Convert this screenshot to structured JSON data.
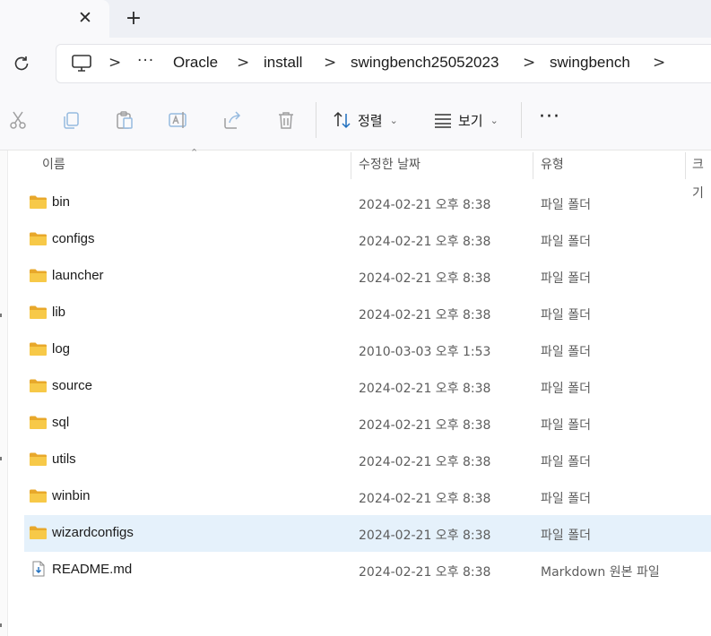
{
  "tabs": {
    "close_label": "✕",
    "new_tab_label": "+"
  },
  "address": {
    "more_label": "···",
    "crumbs": [
      "Oracle",
      "install",
      "swingbench25052023",
      "swingbench"
    ],
    "separator": ">"
  },
  "toolbar": {
    "actions": [
      "cut-icon",
      "copy-icon",
      "paste-icon",
      "rename-icon",
      "share-icon",
      "delete-icon"
    ],
    "sort_label": "정렬",
    "view_label": "보기",
    "more_label": "···"
  },
  "columns": {
    "name": "이름",
    "date": "수정한 날짜",
    "type": "유형",
    "size": "크기"
  },
  "files": [
    {
      "name": "bin",
      "date": "2024-02-21 오후 8:38",
      "type": "파일 폴더",
      "kind": "folder"
    },
    {
      "name": "configs",
      "date": "2024-02-21 오후 8:38",
      "type": "파일 폴더",
      "kind": "folder"
    },
    {
      "name": "launcher",
      "date": "2024-02-21 오후 8:38",
      "type": "파일 폴더",
      "kind": "folder"
    },
    {
      "name": "lib",
      "date": "2024-02-21 오후 8:38",
      "type": "파일 폴더",
      "kind": "folder"
    },
    {
      "name": "log",
      "date": "2010-03-03 오후 1:53",
      "type": "파일 폴더",
      "kind": "folder"
    },
    {
      "name": "source",
      "date": "2024-02-21 오후 8:38",
      "type": "파일 폴더",
      "kind": "folder"
    },
    {
      "name": "sql",
      "date": "2024-02-21 오후 8:38",
      "type": "파일 폴더",
      "kind": "folder"
    },
    {
      "name": "utils",
      "date": "2024-02-21 오후 8:38",
      "type": "파일 폴더",
      "kind": "folder"
    },
    {
      "name": "winbin",
      "date": "2024-02-21 오후 8:38",
      "type": "파일 폴더",
      "kind": "folder"
    },
    {
      "name": "wizardconfigs",
      "date": "2024-02-21 오후 8:38",
      "type": "파일 폴더",
      "kind": "folder",
      "selected": true
    },
    {
      "name": "README.md",
      "date": "2024-02-21 오후 8:38",
      "type": "Markdown 원본 파일",
      "kind": "file"
    }
  ],
  "colors": {
    "selected_row": "#e5f1fb",
    "folder_yellow": "#f7c948",
    "chrome_bg": "#f9f9fb"
  }
}
